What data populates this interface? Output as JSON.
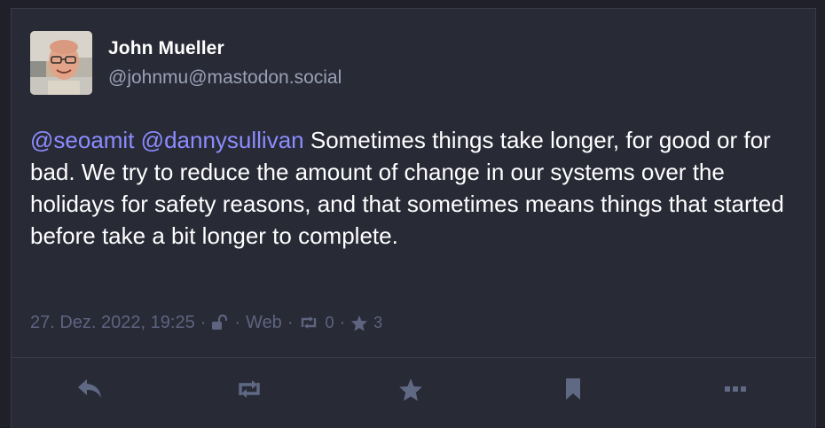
{
  "post": {
    "author": {
      "display_name": "John Mueller",
      "handle": "@johnmu@mastodon.social"
    },
    "content": {
      "mention_1": "@seoamit",
      "mention_2": "@dannysullivan",
      "body": " Sometimes things take longer, for good or for bad. We try to reduce the amount of change in our systems over the holidays for safety reasons, and that sometimes means things that started before take a bit longer to complete."
    },
    "meta": {
      "timestamp": "27. Dez. 2022, 19:25",
      "separator": "·",
      "visibility_icon": "unlocked-icon",
      "application": "Web",
      "boost_icon": "boost-icon",
      "boost_count": "0",
      "favourite_icon": "star-icon",
      "favourite_count": "3"
    },
    "actions": [
      {
        "icon": "reply-icon"
      },
      {
        "icon": "boost-icon"
      },
      {
        "icon": "star-icon"
      },
      {
        "icon": "bookmark-icon"
      },
      {
        "icon": "more-icon"
      }
    ]
  },
  "colors": {
    "background": "#282a36",
    "text": "#ffffff",
    "secondary_text": "#9aa0b6",
    "meta_text": "#5e6480",
    "mention": "#8c8dff",
    "action_icon": "#606984"
  }
}
